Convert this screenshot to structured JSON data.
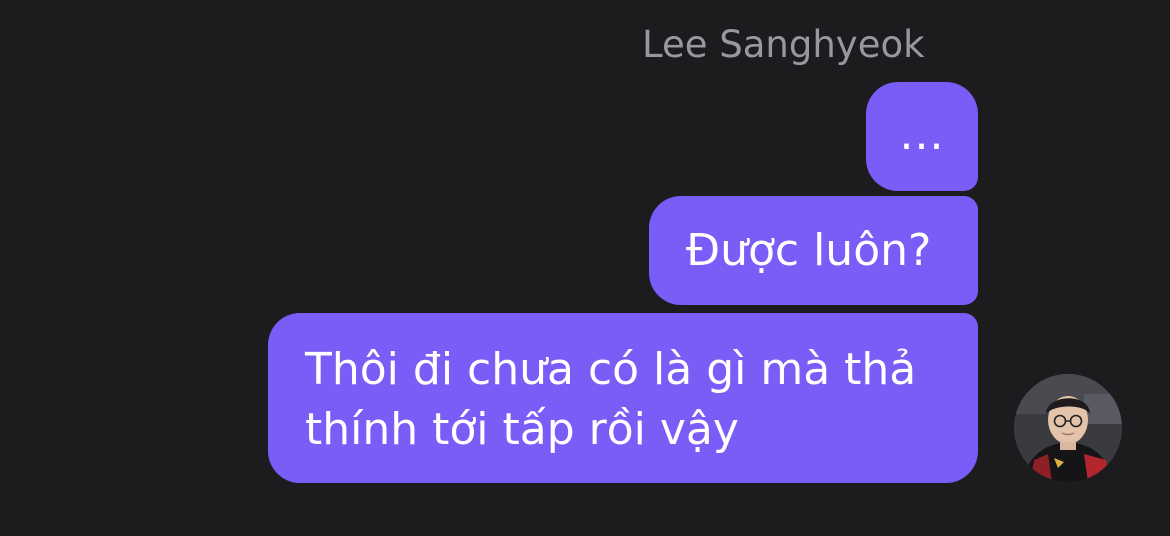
{
  "chat": {
    "sender_name": "Lee Sanghyeok",
    "accent_color": "#7a5cf6",
    "background_color": "#1c1c1e",
    "messages": [
      {
        "text": "..."
      },
      {
        "text": "Được luôn?"
      },
      {
        "text": "Thôi đi chưa có là gì mà thả thính tới tấp rồi vậy"
      }
    ],
    "avatar": {
      "icon": "profile-photo"
    }
  }
}
